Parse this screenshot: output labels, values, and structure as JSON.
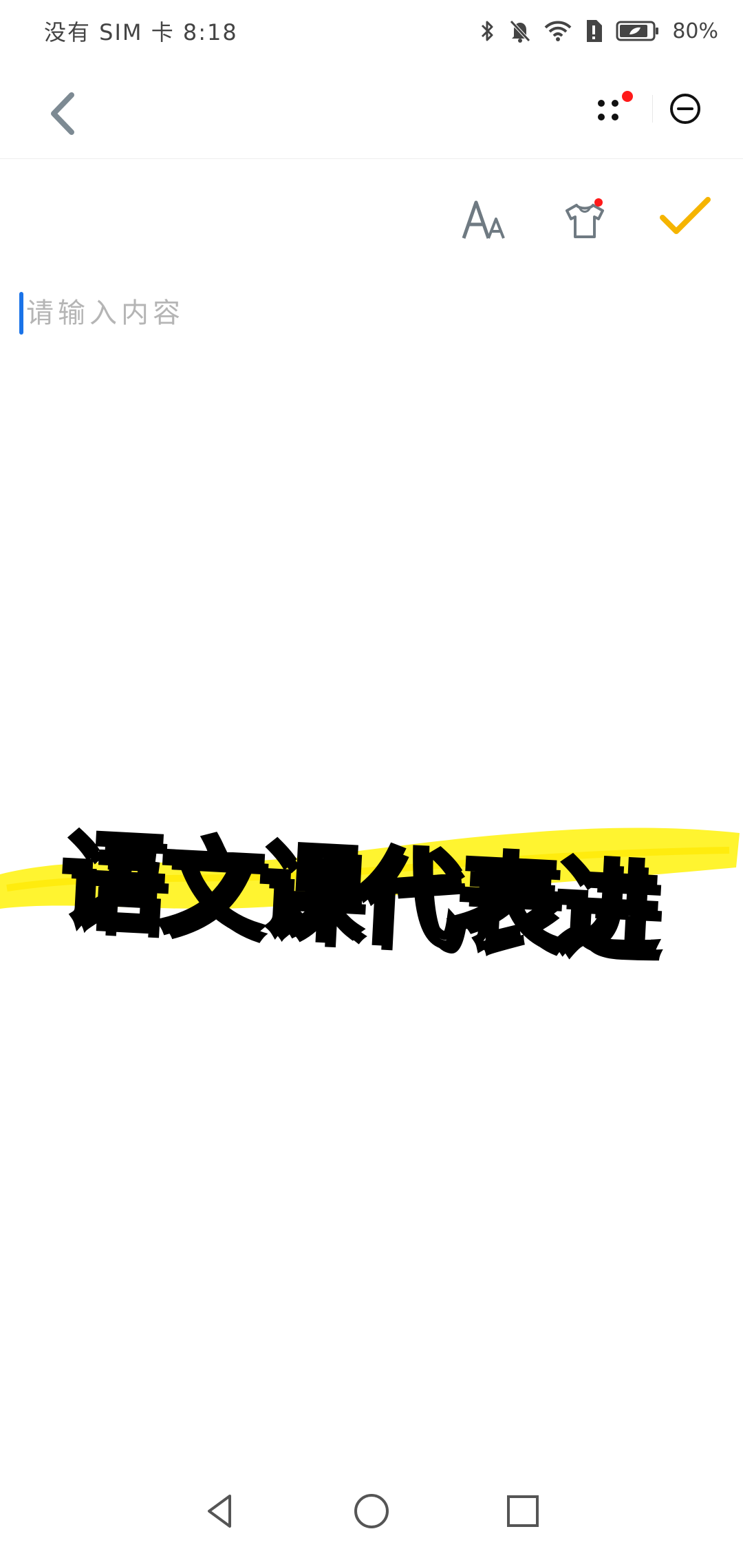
{
  "status_bar": {
    "carrier_time": "没有 SIM 卡 8:18",
    "battery_percent": "80%",
    "icons": [
      "bluetooth-icon",
      "mute-icon",
      "wifi-icon",
      "sim-alert-icon",
      "battery-icon"
    ]
  },
  "top_bar": {
    "back_icon": "chevron-left-icon",
    "menu_icon": "more-dots-icon",
    "close_icon": "minus-circle-icon",
    "notification_dot_color": "#ff1a1a"
  },
  "toolbar": {
    "items": [
      {
        "name": "font-size",
        "icon": "font-size-icon"
      },
      {
        "name": "theme",
        "icon": "shirt-icon"
      },
      {
        "name": "confirm",
        "icon": "checkmark-icon"
      }
    ],
    "accent_color": "#f5b400"
  },
  "editor": {
    "placeholder": "请输入内容",
    "value": "",
    "caret_color": "#1a73e8"
  },
  "banner": {
    "text": "语文课代表进",
    "highlight_color": "#fff31a"
  },
  "nav_bar": {
    "icons": [
      "back-triangle-icon",
      "home-circle-icon",
      "recents-square-icon"
    ]
  }
}
